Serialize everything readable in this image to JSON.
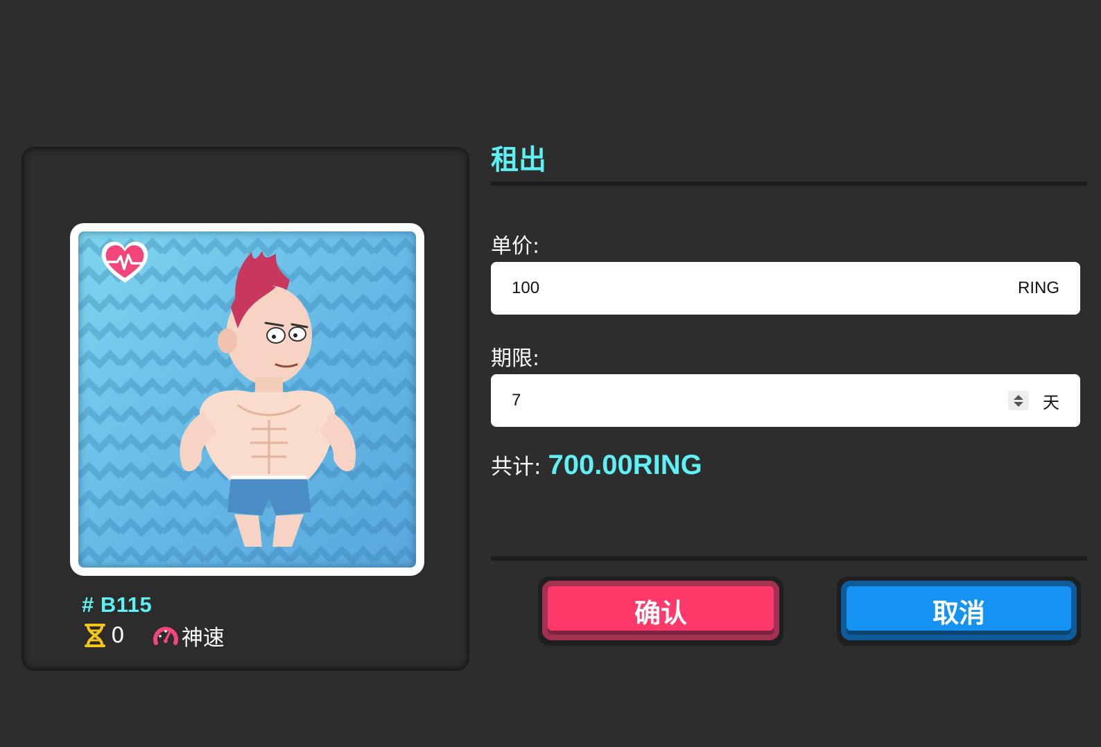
{
  "pet": {
    "id": "# B115",
    "gen_value": "0",
    "speed_value": "神速",
    "badge_icon": "heart-pulse-icon",
    "gen_icon": "dna-icon",
    "speed_icon": "speedometer-icon"
  },
  "panel": {
    "title": "租出",
    "price_label": "单价:",
    "price_value": "100",
    "price_unit": "RING",
    "duration_label": "期限:",
    "duration_value": "7",
    "duration_unit": "天",
    "total_label": "共计:",
    "total_value": "700.00RING"
  },
  "buttons": {
    "confirm": "确认",
    "cancel": "取消"
  },
  "colors": {
    "background": "#2d2d2d",
    "accent": "#5ff0f4",
    "confirm": "#ff3a6a",
    "cancel": "#1593f2"
  }
}
